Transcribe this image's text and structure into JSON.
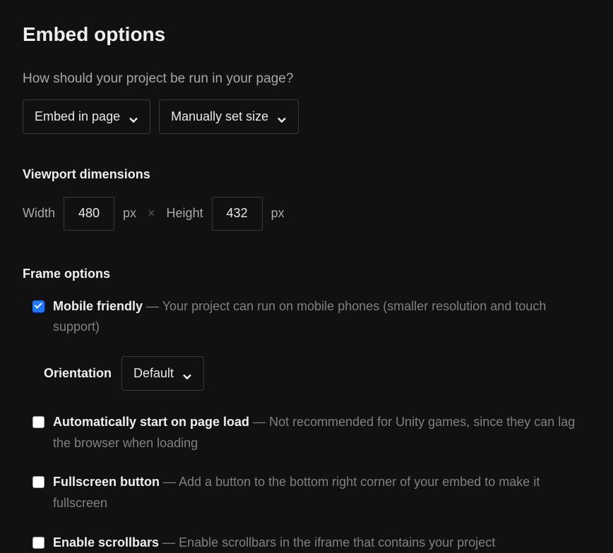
{
  "title": "Embed options",
  "question": "How should your project be run in your page?",
  "dropdowns": {
    "mode": "Embed in page",
    "size_mode": "Manually set size"
  },
  "viewport": {
    "heading": "Viewport dimensions",
    "width_label": "Width",
    "width_value": "480",
    "width_unit": "px",
    "height_label": "Height",
    "height_value": "432",
    "height_unit": "px",
    "times": "×"
  },
  "frame": {
    "heading": "Frame options",
    "mobile": {
      "label": "Mobile friendly",
      "dash": " — ",
      "desc": "Your project can run on mobile phones (smaller resolution and touch support)",
      "checked": true
    },
    "orientation": {
      "label": "Orientation",
      "value": "Default"
    },
    "autostart": {
      "label": "Automatically start on page load",
      "dash": " — ",
      "desc": "Not recommended for Unity games, since they can lag the browser when loading",
      "checked": false
    },
    "fullscreen": {
      "label": "Fullscreen button",
      "dash": " — ",
      "desc": "Add a button to the bottom right corner of your embed to make it fullscreen",
      "checked": false
    },
    "scrollbars": {
      "label": "Enable scrollbars",
      "dash": " — ",
      "desc": "Enable scrollbars in the iframe that contains your project",
      "checked": false
    }
  }
}
